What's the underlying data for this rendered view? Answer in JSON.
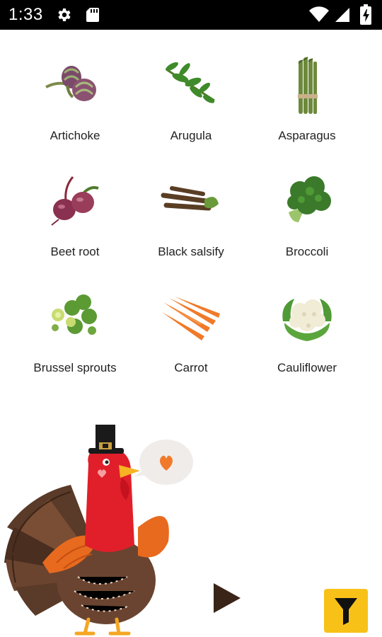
{
  "status_bar": {
    "time": "1:33",
    "icons": [
      "gear-icon",
      "sd-card-icon",
      "wifi-icon",
      "signal-icon",
      "battery-charging-icon"
    ]
  },
  "vegetables": [
    {
      "name": "Artichoke",
      "icon": "artichoke-image"
    },
    {
      "name": "Arugula",
      "icon": "arugula-image"
    },
    {
      "name": "Asparagus",
      "icon": "asparagus-image"
    },
    {
      "name": "Beet root",
      "icon": "beet-root-image"
    },
    {
      "name": "Black salsify",
      "icon": "black-salsify-image"
    },
    {
      "name": "Broccoli",
      "icon": "broccoli-image"
    },
    {
      "name": "Brussel sprouts",
      "icon": "brussel-sprouts-image"
    },
    {
      "name": "Carrot",
      "icon": "carrot-image"
    },
    {
      "name": "Cauliflower",
      "icon": "cauliflower-image"
    }
  ],
  "controls": {
    "play_icon": "play-icon",
    "filter_icon": "filter-icon"
  },
  "colors": {
    "status_bar": "#000000",
    "filter_button": "#f7c117",
    "play_icon": "#3a2418",
    "heart": "#f07a2a"
  }
}
